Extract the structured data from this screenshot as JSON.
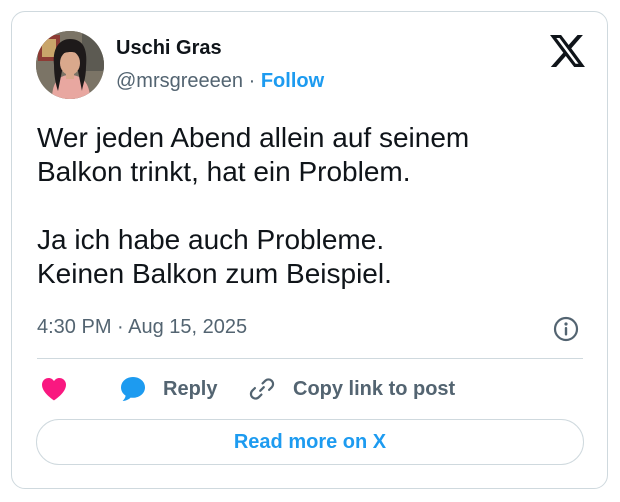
{
  "author": {
    "name": "Uschi Gras",
    "handle": "@mrsgreeeen",
    "separator": "·",
    "follow_label": "Follow",
    "avatar_icon": "profile-photo"
  },
  "tweet": {
    "lines": [
      "Wer jeden Abend allein auf seinem",
      "Balkon trinkt, hat ein Problem.",
      "Ja ich habe auch Probleme.",
      "Keinen Balkon zum Beispiel."
    ],
    "timestamp": "4:30 PM · Aug 15, 2025"
  },
  "actions": {
    "reply_label": "Reply",
    "copy_link_label": "Copy link to post",
    "read_more_label": "Read more on X"
  },
  "icons": {
    "brand": "x-logo-icon",
    "info": "info-icon",
    "like": "heart-icon",
    "reply": "reply-bubble-icon",
    "copy": "link-icon"
  },
  "colors": {
    "accent": "#1d9bf0",
    "like": "#f91880",
    "text": "#0f1419",
    "muted": "#536471",
    "border": "#cfd9de"
  }
}
